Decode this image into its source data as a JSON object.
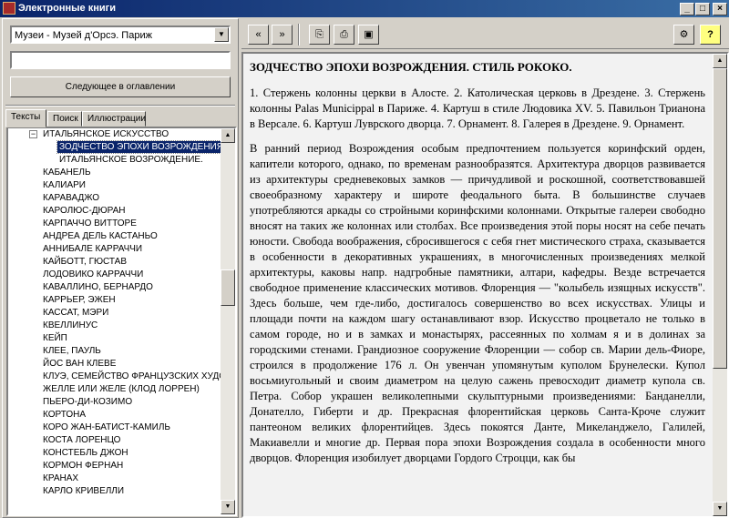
{
  "window": {
    "title": "Электронные книги",
    "minimize": "_",
    "maximize": "□",
    "close": "×"
  },
  "left": {
    "museum_select": "Музеи - Музей д'Орсэ. Париж",
    "search_value": "",
    "next_button": "Следующее в оглавлении",
    "tabs": [
      "Тексты",
      "Поиск",
      "Иллюстрации"
    ],
    "tree": [
      "ИТАЛЬЯНСКОЕ ИСКУССТВО",
      "ЗОДЧЕСТВО ЭПОХИ ВОЗРОЖДЕНИЯ. С",
      "ИТАЛЬЯНСКОЕ ВОЗРОЖДЕНИЕ.",
      "КАБАНЕЛЬ",
      "КАЛИАРИ",
      "КАРАВАДЖО",
      "КАРОЛЮС-ДЮРАН",
      "КАРПАЧЧО ВИТТОРЕ",
      "АНДРЕА ДЕЛЬ КАСТАНЬО",
      "АННИБАЛЕ КАРРАЧЧИ",
      "КАЙБОТТ, ГЮСТАВ",
      "ЛОДОВИКО КАРРАЧЧИ",
      "КАВАЛЛИНО, БЕРНАРДО",
      "КАРРЬЕР, ЭЖЕН",
      "КАССАТ, МЭРИ",
      "КВЕЛЛИНУС",
      "КЕЙП",
      "КЛЕЕ, ПАУЛЬ",
      "ЙОС ВАН КЛЕВЕ",
      "КЛУЭ, СЕМЕЙСТВО ФРАНЦУЗСКИХ ХУДО",
      "ЖЕЛЛЕ ИЛИ ЖЕЛЕ (КЛОД ЛОРРЕН)",
      "ПЬЕРО-ДИ-КОЗИМО",
      "КОРТОНА",
      "КОРО ЖАН-БАТИСТ-КАМИЛЬ",
      "КОСТА ЛОРЕНЦО",
      "КОНСТЕБЛЬ ДЖОН",
      "КОРМОН ФЕРНАН",
      "КРАНАХ",
      "КАРЛО КРИВЕЛЛИ"
    ]
  },
  "doc": {
    "title": "ЗОДЧЕСТВО ЭПОХИ ВОЗРОЖДЕНИЯ. СТИЛЬ РОКОКО.",
    "captions": "1. Стержень колонны церкви в Алосте. 2. Католическая церковь в Дрездене. 3. Стержень колонны Palas Municippal в Париже. 4. Картуш в стиле Людовика XV. 5. Павильон Трианона в Версале. 6. Картуш Луврского дворца. 7. Орнамент. 8. Галерея в Дрездене. 9. Орнамент.",
    "body": "В ранний период Возрождения особым предпочтением пользуется коринфский орден, капители которого, однако, по временам разнообразятся. Архитектура дворцов развивается из архитектуры средневековых замков — причудливой и роскошной, соответствовавшей своеобразному характеру и широте феодального быта. В большинстве случаев употребляются аркады со стройными коринфскими колоннами. Открытые галереи свободно вносят на таких же колоннах или столбах. Все произведения этой поры носят на себе печать юности. Свобода воображения, сбросившегося с себя гнет мистического страха, сказывается в особенности в декоративных украшениях, в многочисленных произведениях мелкой архитектуры, каковы напр. надгробные памятники, алтари, кафедры. Везде встречается свободное применение классических мотивов. Флоренция — \"колыбель изящных искусств\". Здесь больше, чем где-либо, достигалось совершенство во всех искусствах. Улицы и площади почти на каждом шагу останавливают взор. Искусство процветало не только в самом городе, но и в замках и монастырях, рассеянных по холмам я и в долинах за городскими стенами. Грандиозное сооружение Флоренции — собор св. Марии дель-Фиоре, строился в продолжение 176 л. Он увенчан упомянутым куполом Брунелески. Купол восьмиугольный и своим диаметром на целую сажень превосходит диаметр купола св. Петра. Собор украшен великолепными скульптурными произведениями: Банданелли, Донателло, Гиберти и др. Прекрасная флорентийская церковь Санта-Кроче служит пантеоном великих флорентийцев. Здесь покоятся Данте, Микеланджело, Галилей, Макиавелли и многие др. Первая пора эпохи Возрождения создала в особенности много дворцов. Флоренция изобилует дворцами Гордого Строцци, как бы"
  },
  "toolbar": {
    "back": "«",
    "forward": "»",
    "copy": "⎘",
    "print": "⎙",
    "export": "▣",
    "settings": "⚙",
    "help": "?"
  },
  "colors": {
    "title_bar": "#0a246a",
    "selection": "#0a246a",
    "face": "#d4d0c8"
  }
}
